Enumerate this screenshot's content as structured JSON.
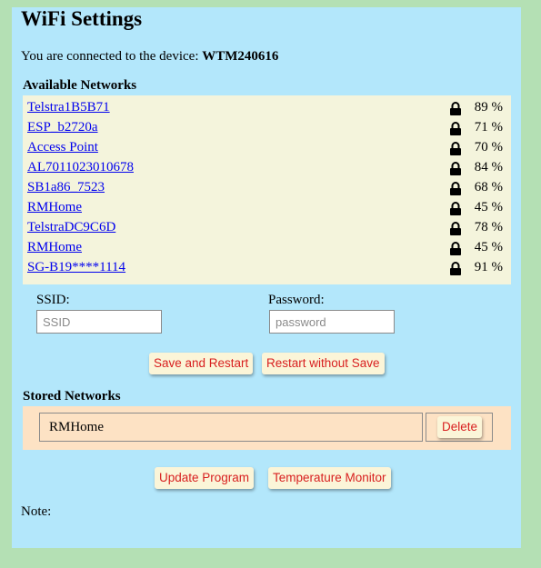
{
  "page": {
    "title": "WiFi Settings",
    "connected_prefix": "You are connected to the device:",
    "device_name": "WTM240616"
  },
  "available": {
    "heading": "Available Networks",
    "networks": [
      {
        "ssid": "Telstra1B5B71",
        "signal": "89 %",
        "icon": "lock-icon"
      },
      {
        "ssid": "ESP_b2720a",
        "signal": "71 %",
        "icon": "lock-icon"
      },
      {
        "ssid": "Access Point",
        "signal": "70 %",
        "icon": "lock-icon"
      },
      {
        "ssid": "AL7011023010678",
        "signal": "84 %",
        "icon": "lock-icon"
      },
      {
        "ssid": "SB1a86_7523",
        "signal": "68 %",
        "icon": "lock-icon"
      },
      {
        "ssid": "RMHome",
        "signal": "45 %",
        "icon": "lock-icon"
      },
      {
        "ssid": "TelstraDC9C6D",
        "signal": "78 %",
        "icon": "lock-icon"
      },
      {
        "ssid": "RMHome",
        "signal": "45 %",
        "icon": "lock-icon"
      },
      {
        "ssid": "SG-B19****1114",
        "signal": "91 %",
        "icon": "lock-icon"
      }
    ]
  },
  "form": {
    "ssid_label": "SSID:",
    "ssid_placeholder": "SSID",
    "ssid_value": "",
    "password_label": "Password:",
    "password_placeholder": "password",
    "password_value": "",
    "save_restart_label": "Save and Restart",
    "restart_no_save_label": "Restart without Save"
  },
  "stored": {
    "heading": "Stored Networks",
    "networks": [
      {
        "ssid": "RMHome",
        "delete_label": "Delete"
      }
    ]
  },
  "footer": {
    "update_label": "Update Program",
    "temp_monitor_label": "Temperature Monitor",
    "note_label": "Note:"
  },
  "colors": {
    "page_background": "#b4e0b4",
    "panel_background": "#b3e7fb",
    "networks_box": "#f4f4dc",
    "stored_box": "#fde2c4",
    "button_background": "#fbf5d8",
    "button_text": "#d82020",
    "link": "#0000ee"
  }
}
